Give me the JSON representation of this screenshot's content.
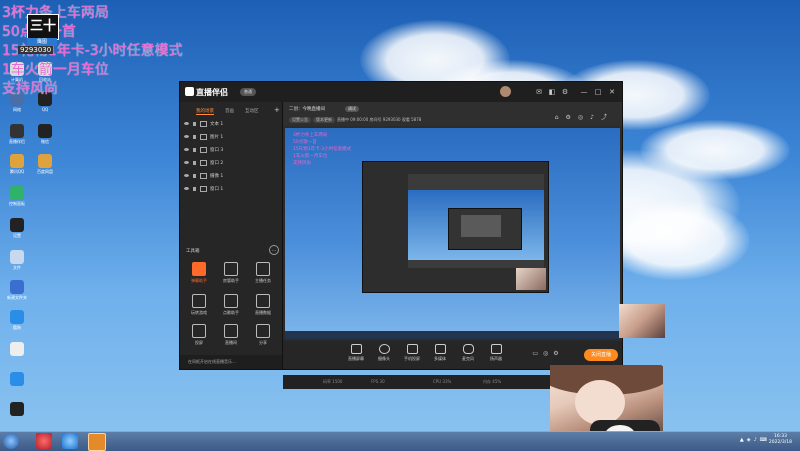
{
  "overlay": {
    "lines": [
      "3杯力条上车两局",
      "50点歌一首",
      "15礼物1年卡-3小时任意模式",
      "1车火箭一月车位",
      "支持风尚"
    ],
    "logo_text": "三十",
    "logo_sub": "鹰图",
    "logo_number": "9293030"
  },
  "desktop_icons": [
    "计算机",
    "回收站",
    "网络",
    "QQ",
    "直播伴侣",
    "微信",
    "腾讯QQ",
    "百度网盘",
    "控制面板",
    "设置",
    "文件",
    "新建文件夹",
    "酷狗"
  ],
  "app": {
    "name": "直播伴侣",
    "version": "普通",
    "window_controls": [
      "—",
      "□",
      "✕"
    ],
    "left_tabs": [
      "我的场景",
      "音画",
      "互动区"
    ],
    "scenes": [
      "文本 1",
      "图片 1",
      "窗口 3",
      "窗口 2",
      "摄像 1",
      "窗口 1"
    ],
    "tools_title": "工具箱",
    "tools_more": "…",
    "tools": [
      "弹幕助手",
      "房管助手",
      "主播任务",
      "玩转游戏",
      "点歌助手",
      "直播数据",
      "投屏",
      "直播间",
      "分享",
      "连麦",
      "PK",
      "更多"
    ],
    "notice": "在同框开启在线直播音乐...",
    "info": {
      "title": "二创：今晚直播间",
      "tag": "调试",
      "chips": [
        "设置公告",
        "版本更新"
      ],
      "meta": "直播中 09:00:00  房间号 9293030  观看 5878"
    },
    "preview_overlay": [
      "3杯力条上车两局",
      "50点歌一首",
      "15礼物1年卡-3小时任意模式",
      "1车火箭一月车位",
      "支持风尚"
    ],
    "bottom_tools": [
      "直播屏幕",
      "摄像头",
      "手机投屏",
      "多媒体",
      "麦克风",
      "扬声器"
    ],
    "go_live": "关闭直播",
    "status": [
      "码率 1500",
      "FPS 30",
      "CPU 33%",
      "内存 45%",
      "00:00:00"
    ]
  },
  "taskbar": {
    "time": "16:33",
    "date": "2022/3/18"
  },
  "colors": {
    "accent": "#ff8a1e",
    "overlay_text": "#e26ad0",
    "sky_top": "#1d5fb5",
    "sky_bottom": "#8cc4f0"
  }
}
